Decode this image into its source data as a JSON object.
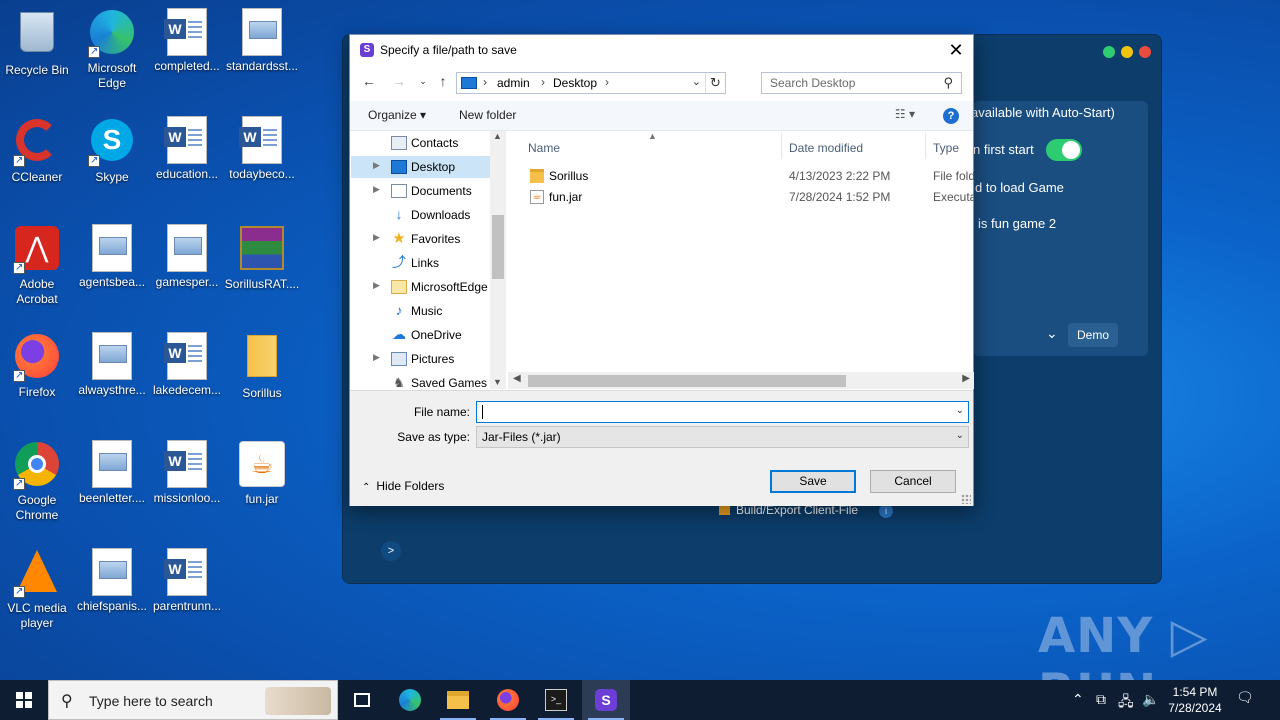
{
  "desktop": {
    "icons": [
      {
        "label": "Recycle Bin",
        "kind": "recycle-bin"
      },
      {
        "label": "Microsoft Edge",
        "kind": "edge"
      },
      {
        "label": "completed...",
        "kind": "word"
      },
      {
        "label": "standardsst...",
        "kind": "image"
      },
      {
        "label": "CCleaner",
        "kind": "ccleaner"
      },
      {
        "label": "Skype",
        "kind": "skype"
      },
      {
        "label": "education...",
        "kind": "word"
      },
      {
        "label": "todaybeco...",
        "kind": "word"
      },
      {
        "label": "Adobe Acrobat",
        "kind": "acrobat"
      },
      {
        "label": "agentsbea...",
        "kind": "image"
      },
      {
        "label": "gamesper...",
        "kind": "image"
      },
      {
        "label": "SorillusRAT....",
        "kind": "winrar"
      },
      {
        "label": "Firefox",
        "kind": "firefox"
      },
      {
        "label": "alwaysthre...",
        "kind": "image"
      },
      {
        "label": "lakedecem...",
        "kind": "word"
      },
      {
        "label": "Sorillus",
        "kind": "folder"
      },
      {
        "label": "Google Chrome",
        "kind": "chrome"
      },
      {
        "label": "beenletter....",
        "kind": "image"
      },
      {
        "label": "missionloo...",
        "kind": "word"
      },
      {
        "label": "fun.jar",
        "kind": "java"
      },
      {
        "label": "VLC media player",
        "kind": "vlc"
      },
      {
        "label": "chiefspanis...",
        "kind": "image"
      },
      {
        "label": "parentrunn...",
        "kind": "word"
      }
    ]
  },
  "background_app": {
    "text1": "available with Auto-Start)",
    "text2": "n first start",
    "text3": "d to load Game",
    "text4": "is fun game 2",
    "demo": "Demo",
    "build": "Build/Export Client-File",
    "prompt": ">",
    "colors": {
      "green": "#2ecc71",
      "yellow": "#f1c40f",
      "red": "#e74c3c"
    }
  },
  "dialog": {
    "title": "Specify a file/path to save",
    "breadcrumb": [
      "admin",
      "Desktop"
    ],
    "search_placeholder": "Search Desktop",
    "organize": "Organize ▾",
    "new_folder": "New folder",
    "help": "?",
    "nav_items": [
      {
        "label": "Contacts",
        "expandable": false,
        "selected": false
      },
      {
        "label": "Desktop",
        "expandable": true,
        "selected": true
      },
      {
        "label": "Documents",
        "expandable": true,
        "selected": false
      },
      {
        "label": "Downloads",
        "expandable": false,
        "selected": false
      },
      {
        "label": "Favorites",
        "expandable": true,
        "selected": false
      },
      {
        "label": "Links",
        "expandable": false,
        "selected": false
      },
      {
        "label": "MicrosoftEdge",
        "expandable": true,
        "selected": false
      },
      {
        "label": "Music",
        "expandable": false,
        "selected": false
      },
      {
        "label": "OneDrive",
        "expandable": false,
        "selected": false
      },
      {
        "label": "Pictures",
        "expandable": true,
        "selected": false
      },
      {
        "label": "Saved Games",
        "expandable": false,
        "selected": false
      }
    ],
    "columns": {
      "name": "Name",
      "date": "Date modified",
      "type": "Type"
    },
    "files": [
      {
        "name": "Sorillus",
        "date": "4/13/2023 2:22 PM",
        "type": "File fold",
        "kind": "folder"
      },
      {
        "name": "fun.jar",
        "date": "7/28/2024 1:52 PM",
        "type": "Executa",
        "kind": "jar"
      }
    ],
    "file_name_label": "File name:",
    "file_name_value": "",
    "save_type_label": "Save as type:",
    "save_type_value": "Jar-Files (*.jar)",
    "save": "Save",
    "cancel": "Cancel",
    "hide_folders": "Hide Folders"
  },
  "taskbar": {
    "search_text": "Type here to search",
    "time": "1:54 PM",
    "date": "7/28/2024"
  },
  "watermark": "ANY ▷ RUN"
}
